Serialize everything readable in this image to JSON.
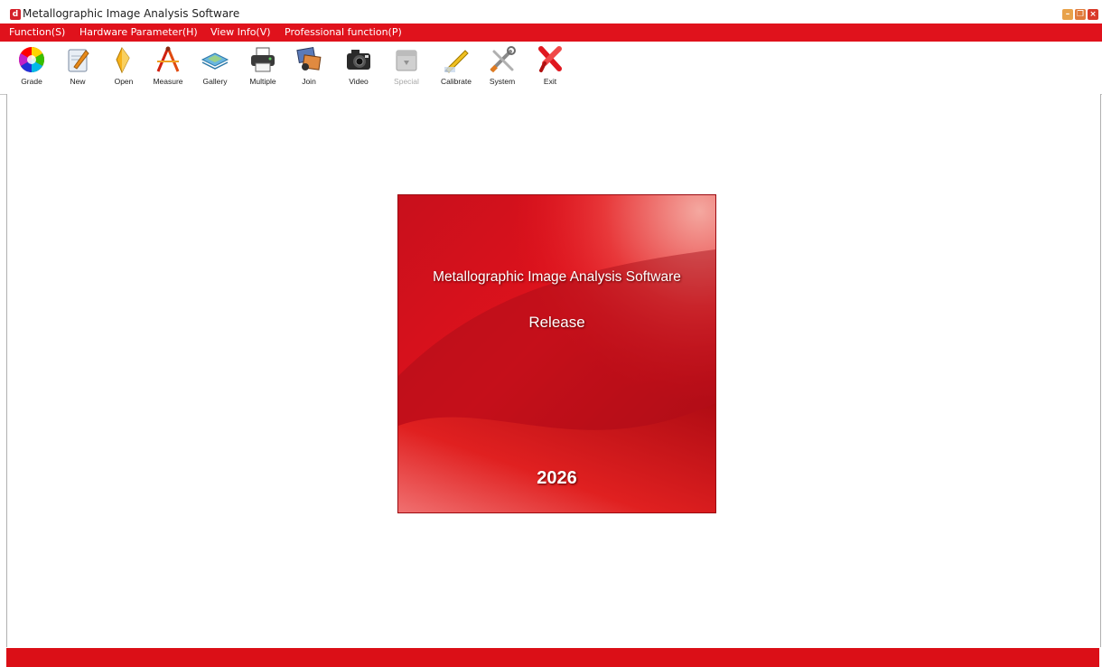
{
  "window": {
    "title": "Metallographic Image Analysis Software",
    "app_icon_glyph": "d",
    "controls": [
      "minimize-icon",
      "restore-icon",
      "close-icon"
    ]
  },
  "menu": [
    {
      "label": "Function(S)"
    },
    {
      "label": "Hardware Parameter(H)"
    },
    {
      "label": "View Info(V)"
    },
    {
      "label": "Professional function(P)"
    }
  ],
  "toolbar": [
    {
      "label": "Grade",
      "icon": "color-wheel-icon",
      "enabled": true
    },
    {
      "label": "New",
      "icon": "new-document-icon",
      "enabled": true
    },
    {
      "label": "Open",
      "icon": "open-folder-icon",
      "enabled": true
    },
    {
      "label": "Measure",
      "icon": "measure-compass-icon",
      "enabled": true
    },
    {
      "label": "Gallery",
      "icon": "gallery-icon",
      "enabled": true
    },
    {
      "label": "Multiple",
      "icon": "printer-icon",
      "enabled": true
    },
    {
      "label": "Join",
      "icon": "join-images-icon",
      "enabled": true
    },
    {
      "label": "Video",
      "icon": "camera-icon",
      "enabled": true
    },
    {
      "label": "Special",
      "icon": "special-box-icon",
      "enabled": false
    },
    {
      "label": "Calibrate",
      "icon": "calibrate-pencil-icon",
      "enabled": true
    },
    {
      "label": "System",
      "icon": "tools-icon",
      "enabled": true
    },
    {
      "label": "Exit",
      "icon": "exit-icon",
      "enabled": true
    }
  ],
  "splash": {
    "title": "Metallographic Image Analysis Software",
    "subtitle": "Release",
    "year": "2026"
  },
  "colors": {
    "accent": "#e0121c",
    "splash_dark": "#b8101a",
    "splash_light": "#f08080"
  }
}
